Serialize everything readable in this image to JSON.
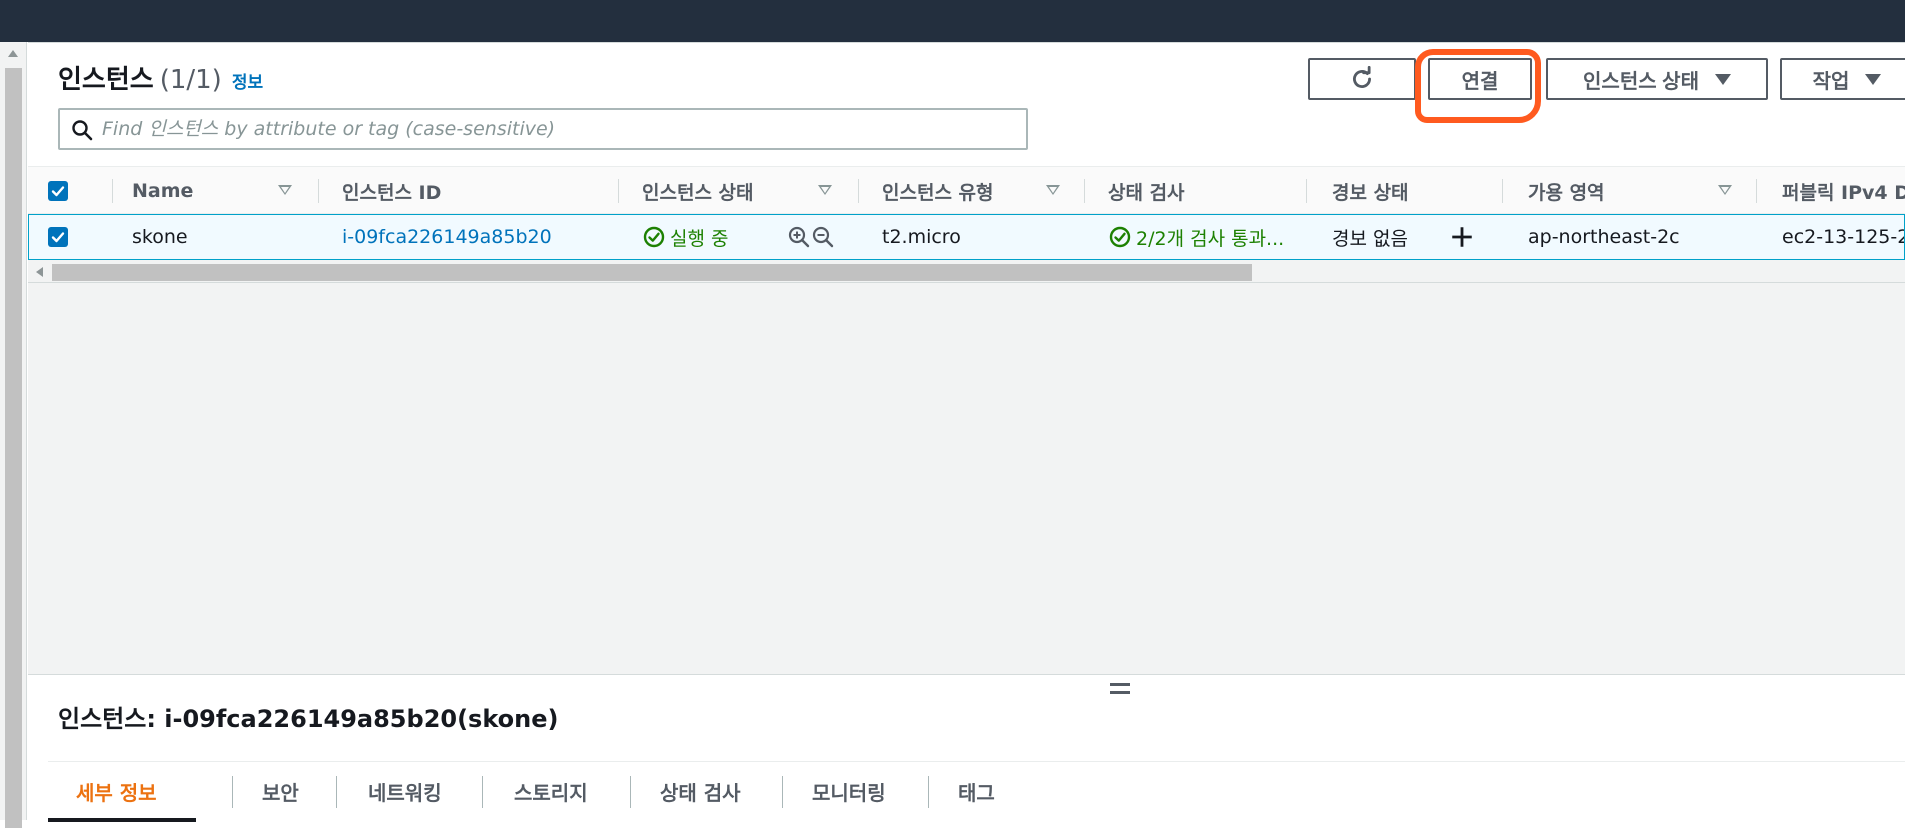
{
  "panel": {
    "title": "인스턴스",
    "count": "(1/1)",
    "info_link": "정보"
  },
  "toolbar": {
    "refresh_icon": "refresh-icon",
    "connect_label": "연결",
    "instance_state_label": "인스턴스 상태",
    "actions_label": "작업"
  },
  "search": {
    "placeholder": "Find 인스턴스 by attribute or tag (case-sensitive)",
    "value": ""
  },
  "table": {
    "headers": {
      "name": "Name",
      "instance_id": "인스턴스 ID",
      "instance_state": "인스턴스 상태",
      "instance_type": "인스턴스 유형",
      "status_check": "상태 검사",
      "alarm_state": "경보 상태",
      "availability_zone": "가용 영역",
      "public_ipv4": "퍼블릭 IPv4 D"
    },
    "rows": [
      {
        "selected": true,
        "name": "skone",
        "instance_id": "i-09fca226149a85b20",
        "instance_state": "실행 중",
        "instance_type": "t2.micro",
        "status_check": "2/2개 검사 통과...",
        "alarm_state": "경보 없음",
        "availability_zone": "ap-northeast-2c",
        "public_ipv4": "ec2-13-125-2"
      }
    ]
  },
  "detail": {
    "title": "인스턴스: i-09fca226149a85b20(skone)",
    "tabs": [
      {
        "label": "세부 정보",
        "active": true
      },
      {
        "label": "보안",
        "active": false
      },
      {
        "label": "네트워킹",
        "active": false
      },
      {
        "label": "스토리지",
        "active": false
      },
      {
        "label": "상태 검사",
        "active": false
      },
      {
        "label": "모니터링",
        "active": false
      },
      {
        "label": "태그",
        "active": false
      }
    ]
  },
  "colors": {
    "header_bg": "#232f3e",
    "link": "#0073bb",
    "success": "#1d8102",
    "accent": "#ec7211",
    "annotation": "#ff5a1f"
  }
}
